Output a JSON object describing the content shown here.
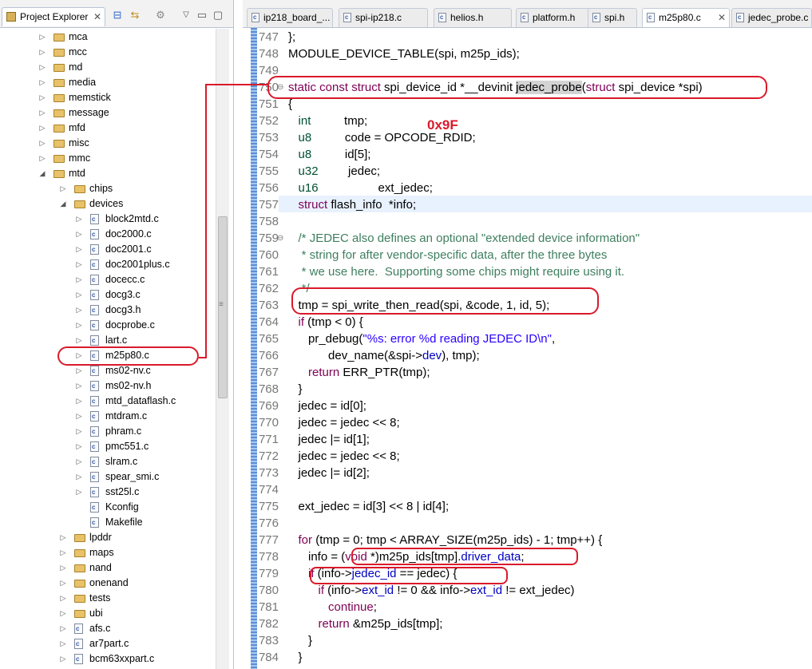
{
  "left_panel": {
    "tab_title": "Project Explorer",
    "tree": [
      {
        "label": "mca",
        "kind": "folder",
        "indent": 0,
        "arrow": "▷"
      },
      {
        "label": "mcc",
        "kind": "folder",
        "indent": 0,
        "arrow": "▷"
      },
      {
        "label": "md",
        "kind": "folder",
        "indent": 0,
        "arrow": "▷"
      },
      {
        "label": "media",
        "kind": "folder",
        "indent": 0,
        "arrow": "▷"
      },
      {
        "label": "memstick",
        "kind": "folder",
        "indent": 0,
        "arrow": "▷"
      },
      {
        "label": "message",
        "kind": "folder",
        "indent": 0,
        "arrow": "▷"
      },
      {
        "label": "mfd",
        "kind": "folder",
        "indent": 0,
        "arrow": "▷"
      },
      {
        "label": "misc",
        "kind": "folder",
        "indent": 0,
        "arrow": "▷"
      },
      {
        "label": "mmc",
        "kind": "folder",
        "indent": 0,
        "arrow": "▷"
      },
      {
        "label": "mtd",
        "kind": "folder",
        "indent": 0,
        "arrow": "◢"
      },
      {
        "label": "chips",
        "kind": "folder",
        "indent": 1,
        "arrow": "▷"
      },
      {
        "label": "devices",
        "kind": "folder",
        "indent": 1,
        "arrow": "◢"
      },
      {
        "label": "block2mtd.c",
        "kind": "file",
        "indent": 2,
        "arrow": "▷"
      },
      {
        "label": "doc2000.c",
        "kind": "file",
        "indent": 2,
        "arrow": "▷"
      },
      {
        "label": "doc2001.c",
        "kind": "file",
        "indent": 2,
        "arrow": "▷"
      },
      {
        "label": "doc2001plus.c",
        "kind": "file",
        "indent": 2,
        "arrow": "▷"
      },
      {
        "label": "docecc.c",
        "kind": "file",
        "indent": 2,
        "arrow": "▷"
      },
      {
        "label": "docg3.c",
        "kind": "file",
        "indent": 2,
        "arrow": "▷"
      },
      {
        "label": "docg3.h",
        "kind": "file",
        "indent": 2,
        "arrow": "▷"
      },
      {
        "label": "docprobe.c",
        "kind": "file",
        "indent": 2,
        "arrow": "▷"
      },
      {
        "label": "lart.c",
        "kind": "file",
        "indent": 2,
        "arrow": "▷"
      },
      {
        "label": "m25p80.c",
        "kind": "file",
        "indent": 2,
        "arrow": "▷"
      },
      {
        "label": "ms02-nv.c",
        "kind": "file",
        "indent": 2,
        "arrow": "▷"
      },
      {
        "label": "ms02-nv.h",
        "kind": "file",
        "indent": 2,
        "arrow": "▷"
      },
      {
        "label": "mtd_dataflash.c",
        "kind": "file",
        "indent": 2,
        "arrow": "▷"
      },
      {
        "label": "mtdram.c",
        "kind": "file",
        "indent": 2,
        "arrow": "▷"
      },
      {
        "label": "phram.c",
        "kind": "file",
        "indent": 2,
        "arrow": "▷"
      },
      {
        "label": "pmc551.c",
        "kind": "file",
        "indent": 2,
        "arrow": "▷"
      },
      {
        "label": "slram.c",
        "kind": "file",
        "indent": 2,
        "arrow": "▷"
      },
      {
        "label": "spear_smi.c",
        "kind": "file",
        "indent": 2,
        "arrow": "▷"
      },
      {
        "label": "sst25l.c",
        "kind": "file",
        "indent": 2,
        "arrow": "▷"
      },
      {
        "label": "Kconfig",
        "kind": "file",
        "indent": 2,
        "arrow": ""
      },
      {
        "label": "Makefile",
        "kind": "file",
        "indent": 2,
        "arrow": ""
      },
      {
        "label": "lpddr",
        "kind": "folder",
        "indent": 1,
        "arrow": "▷"
      },
      {
        "label": "maps",
        "kind": "folder",
        "indent": 1,
        "arrow": "▷"
      },
      {
        "label": "nand",
        "kind": "folder",
        "indent": 1,
        "arrow": "▷"
      },
      {
        "label": "onenand",
        "kind": "folder",
        "indent": 1,
        "arrow": "▷"
      },
      {
        "label": "tests",
        "kind": "folder",
        "indent": 1,
        "arrow": "▷"
      },
      {
        "label": "ubi",
        "kind": "folder",
        "indent": 1,
        "arrow": "▷"
      },
      {
        "label": "afs.c",
        "kind": "file",
        "indent": 1,
        "arrow": "▷"
      },
      {
        "label": "ar7part.c",
        "kind": "file",
        "indent": 1,
        "arrow": "▷"
      },
      {
        "label": "bcm63xxpart.c",
        "kind": "file",
        "indent": 1,
        "arrow": "▷"
      }
    ]
  },
  "editor": {
    "tabs": [
      {
        "label": "ip218_board_...",
        "active": false
      },
      {
        "label": "spi-ip218.c",
        "active": false
      },
      {
        "label": "helios.h",
        "active": false
      },
      {
        "label": "platform.h",
        "active": false
      },
      {
        "label": "spi.h",
        "active": false
      },
      {
        "label": "m25p80.c",
        "active": true
      },
      {
        "label": "jedec_probe.c",
        "active": false
      }
    ],
    "annotation_text": "0x9F",
    "lines": [
      {
        "n": "747",
        "fold": "",
        "segs": [
          [
            "",
            "};"
          ]
        ]
      },
      {
        "n": "748",
        "fold": "",
        "segs": [
          [
            "",
            "MODULE_DEVICE_TABLE(spi, m25p_ids);"
          ]
        ]
      },
      {
        "n": "749",
        "fold": "",
        "segs": []
      },
      {
        "n": "750",
        "fold": "⊖",
        "segs": [
          [
            "kw",
            "static const struct"
          ],
          [
            "",
            " spi_device_id *__devinit "
          ],
          [
            "hl",
            "jedec_probe"
          ],
          [
            "",
            "("
          ],
          [
            "kw",
            "struct"
          ],
          [
            "",
            " spi_device *spi)"
          ]
        ]
      },
      {
        "n": "751",
        "fold": "",
        "segs": [
          [
            "",
            "{"
          ]
        ]
      },
      {
        "n": "752",
        "fold": "",
        "segs": [
          [
            "",
            "   "
          ],
          [
            "ty",
            "int"
          ],
          [
            "",
            "          tmp;"
          ]
        ]
      },
      {
        "n": "753",
        "fold": "",
        "segs": [
          [
            "",
            "   "
          ],
          [
            "ty",
            "u8"
          ],
          [
            "",
            "          code = OPCODE_RDID;"
          ]
        ]
      },
      {
        "n": "754",
        "fold": "",
        "segs": [
          [
            "",
            "   "
          ],
          [
            "ty",
            "u8"
          ],
          [
            "",
            "          id[5];"
          ]
        ]
      },
      {
        "n": "755",
        "fold": "",
        "segs": [
          [
            "",
            "   "
          ],
          [
            "ty",
            "u32"
          ],
          [
            "",
            "         jedec;"
          ]
        ]
      },
      {
        "n": "756",
        "fold": "",
        "segs": [
          [
            "",
            "   "
          ],
          [
            "ty",
            "u16"
          ],
          [
            "",
            "                  ext_jedec;"
          ]
        ]
      },
      {
        "n": "757",
        "fold": "",
        "segs": [
          [
            "",
            "   "
          ],
          [
            "kw",
            "struct"
          ],
          [
            "",
            " flash_info  *info;"
          ]
        ]
      },
      {
        "n": "758",
        "fold": "",
        "segs": []
      },
      {
        "n": "759",
        "fold": "⊖",
        "segs": [
          [
            "",
            "   "
          ],
          [
            "cm",
            "/* JEDEC also defines an optional \"extended device information\""
          ]
        ]
      },
      {
        "n": "760",
        "fold": "",
        "segs": [
          [
            "cm",
            "    * string for after vendor-specific data, after the three bytes"
          ]
        ]
      },
      {
        "n": "761",
        "fold": "",
        "segs": [
          [
            "cm",
            "    * we use here.  Supporting some chips might require using it."
          ]
        ]
      },
      {
        "n": "762",
        "fold": "",
        "segs": [
          [
            "cm",
            "    */"
          ]
        ]
      },
      {
        "n": "763",
        "fold": "",
        "segs": [
          [
            "",
            "   tmp = spi_write_then_read(spi, &code, 1, id, 5);"
          ]
        ]
      },
      {
        "n": "764",
        "fold": "",
        "segs": [
          [
            "",
            "   "
          ],
          [
            "kw",
            "if"
          ],
          [
            "",
            " (tmp < 0) {"
          ]
        ]
      },
      {
        "n": "765",
        "fold": "",
        "segs": [
          [
            "",
            "      pr_debug("
          ],
          [
            "st",
            "\"%s: error %d reading JEDEC ID\\n\""
          ],
          [
            "",
            ","
          ]
        ]
      },
      {
        "n": "766",
        "fold": "",
        "segs": [
          [
            "",
            "            dev_name(&spi->"
          ],
          [
            "fld",
            "dev"
          ],
          [
            "",
            "), tmp);"
          ]
        ]
      },
      {
        "n": "767",
        "fold": "",
        "segs": [
          [
            "",
            "      "
          ],
          [
            "kw",
            "return"
          ],
          [
            "",
            " ERR_PTR(tmp);"
          ]
        ]
      },
      {
        "n": "768",
        "fold": "",
        "segs": [
          [
            "",
            "   }"
          ]
        ]
      },
      {
        "n": "769",
        "fold": "",
        "segs": [
          [
            "",
            "   jedec = id[0];"
          ]
        ]
      },
      {
        "n": "770",
        "fold": "",
        "segs": [
          [
            "",
            "   jedec = jedec << 8;"
          ]
        ]
      },
      {
        "n": "771",
        "fold": "",
        "segs": [
          [
            "",
            "   jedec |= id[1];"
          ]
        ]
      },
      {
        "n": "772",
        "fold": "",
        "segs": [
          [
            "",
            "   jedec = jedec << 8;"
          ]
        ]
      },
      {
        "n": "773",
        "fold": "",
        "segs": [
          [
            "",
            "   jedec |= id[2];"
          ]
        ]
      },
      {
        "n": "774",
        "fold": "",
        "segs": []
      },
      {
        "n": "775",
        "fold": "",
        "segs": [
          [
            "",
            "   ext_jedec = id[3] << 8 | id[4];"
          ]
        ]
      },
      {
        "n": "776",
        "fold": "",
        "segs": []
      },
      {
        "n": "777",
        "fold": "",
        "segs": [
          [
            "",
            "   "
          ],
          [
            "kw",
            "for"
          ],
          [
            "",
            " (tmp = 0; tmp < ARRAY_SIZE(m25p_ids) - 1; tmp++) {"
          ]
        ]
      },
      {
        "n": "778",
        "fold": "",
        "segs": [
          [
            "",
            "      info = ("
          ],
          [
            "kw",
            "void"
          ],
          [
            "",
            " *)m25p_ids[tmp]."
          ],
          [
            "fld",
            "driver_data"
          ],
          [
            "",
            ";"
          ]
        ]
      },
      {
        "n": "779",
        "fold": "",
        "segs": [
          [
            "",
            "      "
          ],
          [
            "kw",
            "if"
          ],
          [
            "",
            " (info->"
          ],
          [
            "fld",
            "jedec_id"
          ],
          [
            "",
            " == jedec) {"
          ]
        ]
      },
      {
        "n": "780",
        "fold": "",
        "segs": [
          [
            "",
            "         "
          ],
          [
            "kw",
            "if"
          ],
          [
            "",
            " (info->"
          ],
          [
            "fld",
            "ext_id"
          ],
          [
            "",
            " != 0 && info->"
          ],
          [
            "fld",
            "ext_id"
          ],
          [
            "",
            " != ext_jedec)"
          ]
        ]
      },
      {
        "n": "781",
        "fold": "",
        "segs": [
          [
            "",
            "            "
          ],
          [
            "kw",
            "continue"
          ],
          [
            "",
            ";"
          ]
        ]
      },
      {
        "n": "782",
        "fold": "",
        "segs": [
          [
            "",
            "         "
          ],
          [
            "kw",
            "return"
          ],
          [
            "",
            " &m25p_ids[tmp];"
          ]
        ]
      },
      {
        "n": "783",
        "fold": "",
        "segs": [
          [
            "",
            "      }"
          ]
        ]
      },
      {
        "n": "784",
        "fold": "",
        "segs": [
          [
            "",
            "   }"
          ]
        ]
      }
    ]
  },
  "colors": {
    "annotation": "#d91a2a",
    "keyword": "#7f0055",
    "comment": "#3f7f5f",
    "string": "#2a00ff",
    "field": "#0000c0"
  }
}
